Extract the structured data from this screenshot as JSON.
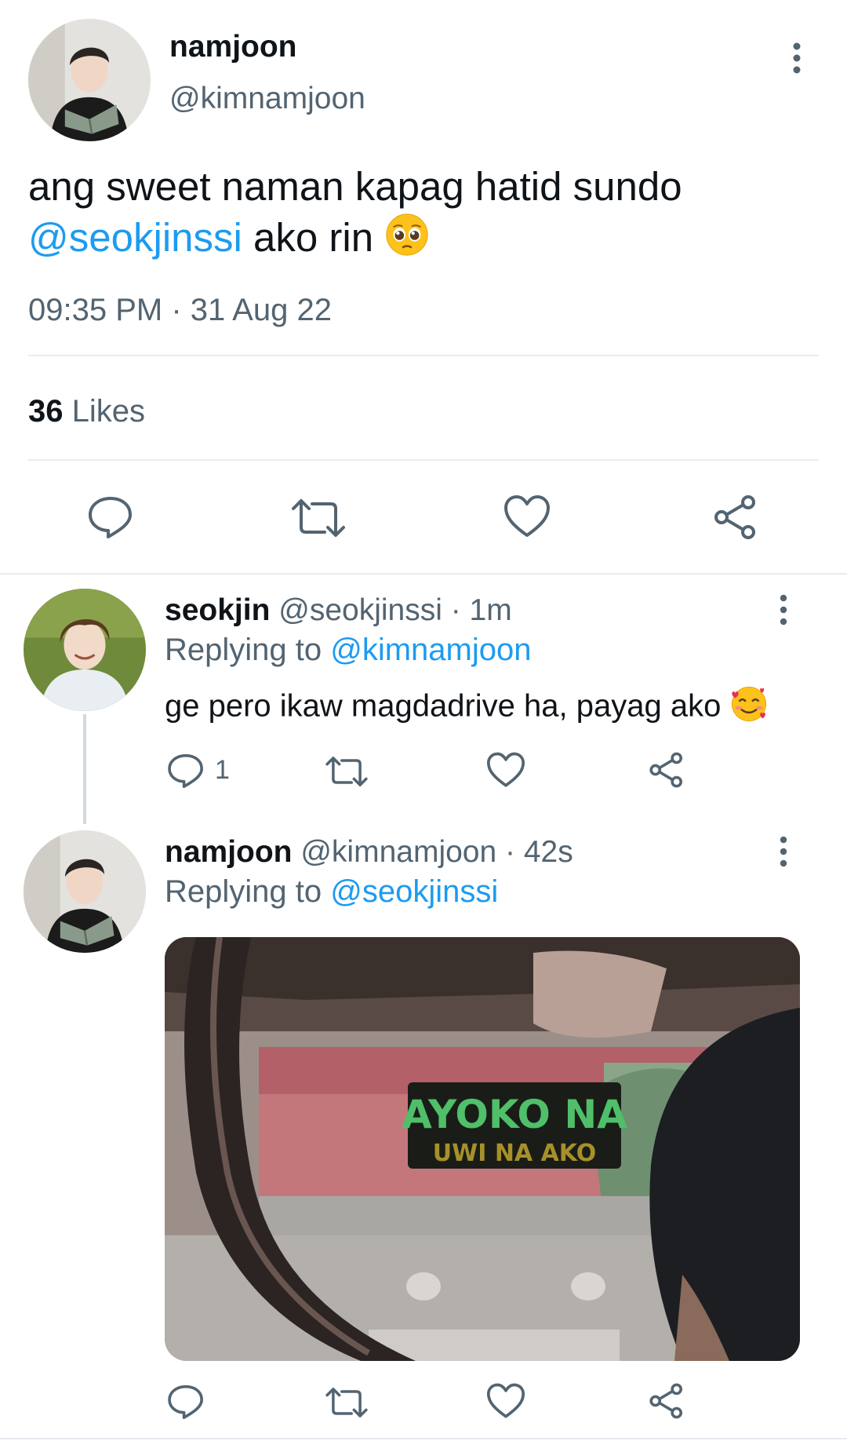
{
  "main_tweet": {
    "name": "namjoon",
    "handle": "@kimnamjoon",
    "text_line1": "ang sweet naman kapag hatid sundo",
    "mention": "@seokjinssi",
    "text_after_mention": " ako rin ",
    "emoji": "pleading-face",
    "time": "09:35 PM",
    "separator": " · ",
    "date": "31 Aug 22",
    "likes_count": "36",
    "likes_label": " Likes"
  },
  "reply1": {
    "name": "seokjin",
    "handle": "@seokjinssi",
    "time": " · 1m",
    "replying_label": "Replying to ",
    "replying_to": "@kimnamjoon",
    "text": "ge pero ikaw magdadrive ha, payag ako ",
    "emoji": "smiling-face-with-hearts",
    "reply_count": "1"
  },
  "reply2": {
    "name": "namjoon",
    "handle": "@kimnamjoon",
    "time": " · 42s",
    "replying_label": "Replying to ",
    "replying_to": "@seokjinssi",
    "image_sign_line1": "AYOKO NA",
    "image_sign_line2": "UWI NA AKO"
  },
  "icons": {
    "more": "more-vertical-icon",
    "reply": "reply-icon",
    "retweet": "retweet-icon",
    "like": "heart-icon",
    "share": "share-icon"
  },
  "colors": {
    "link": "#1d9bf0",
    "secondary_text": "#536471",
    "divider": "#e6ecf0"
  }
}
